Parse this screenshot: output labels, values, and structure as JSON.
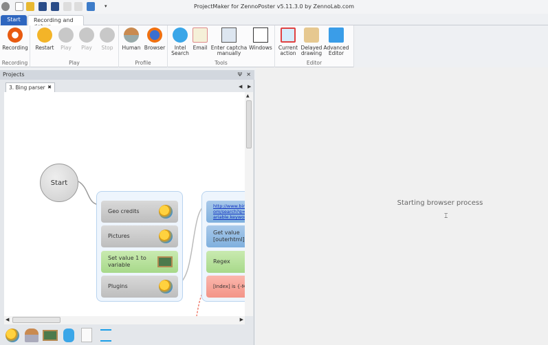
{
  "window": {
    "title": "ProjectMaker for ZennoPoster v5.11.3.0 by ZennoLab.com"
  },
  "ribbon_tabs": [
    "Start",
    "Recording and debug"
  ],
  "ribbon": {
    "groups": [
      {
        "label": "Recording",
        "buttons": [
          "Recording"
        ]
      },
      {
        "label": "Play",
        "buttons": [
          "Restart",
          "Play",
          "Play",
          "Stop"
        ]
      },
      {
        "label": "Profile",
        "buttons": [
          "Human",
          "Browser"
        ]
      },
      {
        "label": "Tools",
        "buttons": [
          "Intel Search",
          "Email",
          "Enter captcha manually",
          "Windows"
        ]
      },
      {
        "label": "Editor",
        "buttons": [
          "Current action",
          "Delayed drawing",
          "Advanced Editor"
        ]
      }
    ]
  },
  "projects_panel": {
    "title": "Projects",
    "pin": "Ψ",
    "close": "✕",
    "doc_tab": "3. Bing parser",
    "doc_close": "✖"
  },
  "canvas": {
    "start": "Start",
    "group1": [
      "Geo credits",
      "Pictures",
      "Set value 1 to variable",
      "Plugins"
    ],
    "group2": [
      "http://www.bing.com/search?q={-Variable.keyword-}",
      "Get value [outerhtml]",
      "Regex",
      "[Index] is {-Macros.PageNum-}"
    ]
  },
  "browser": {
    "status": "Starting browser process",
    "cursor": "⌶"
  }
}
